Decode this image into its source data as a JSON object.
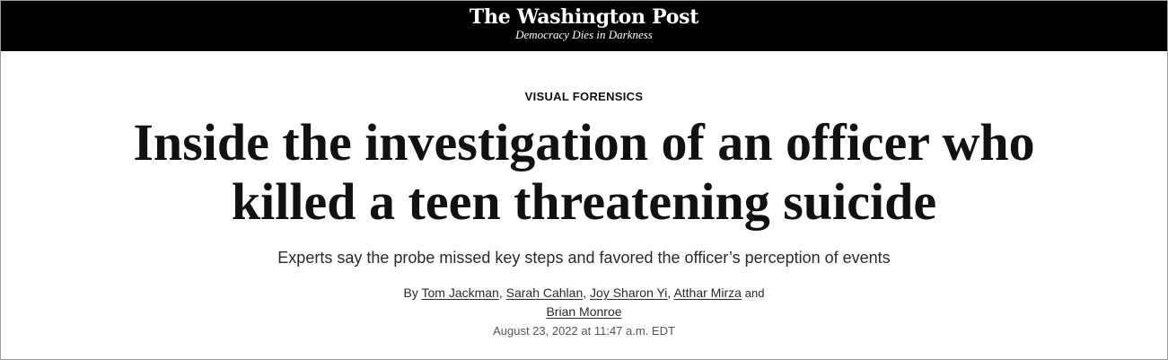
{
  "masthead": {
    "logo": "The Washington Post",
    "tagline": "Democracy Dies in Darkness",
    "background": "#000000"
  },
  "article": {
    "kicker": "VISUAL FORENSICS",
    "headline_line1": "Inside the investigation of an officer who",
    "headline_line2": "killed a teen threatening suicide",
    "dek": "Experts say the probe missed key steps and favored the officer’s perception of events",
    "byline": {
      "prefix": "By",
      "authors": [
        "Tom Jackman",
        "Sarah Cahlan",
        "Joy Sharon Yi",
        "Atthar Mirza",
        "Brian Monroe"
      ],
      "separator": ",",
      "conjunction": "and"
    },
    "dateline": "August 23, 2022 at 11:47 a.m. EDT"
  }
}
